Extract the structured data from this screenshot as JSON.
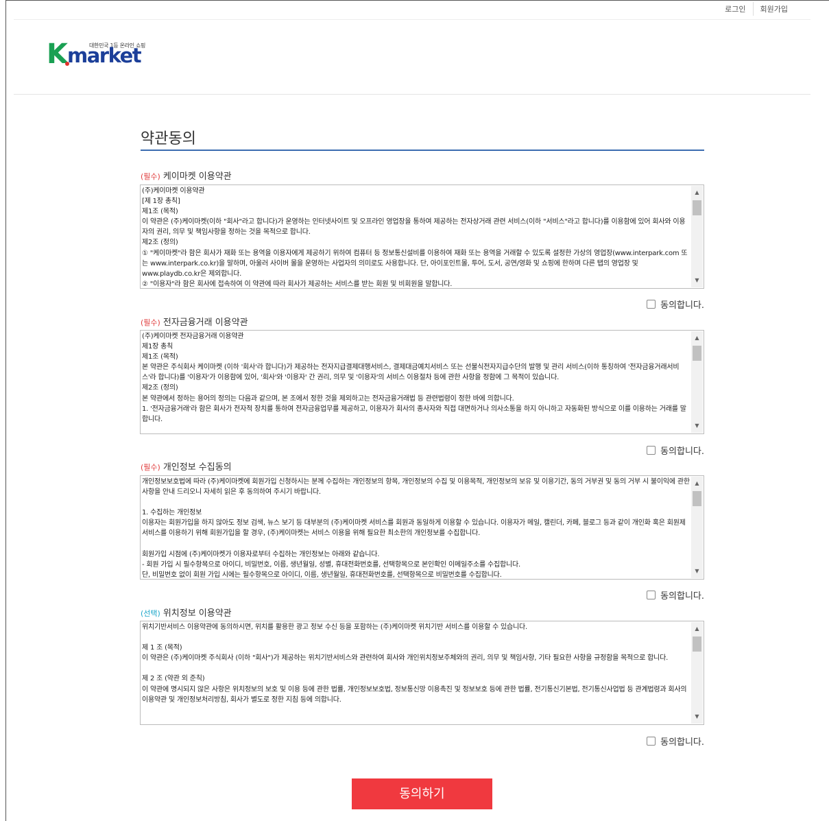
{
  "header": {
    "login_label": "로그인",
    "signup_label": "회원가입"
  },
  "logo": {
    "tagline": "대한민국 1등 온라인 쇼핑",
    "k": "K",
    "word": "market"
  },
  "page_title": "약관동의",
  "sections": [
    {
      "tag": "(필수)",
      "title": "케이마켓 이용약관",
      "text": "(주)케이마켓 이용약관\n[제 1장 총칙]\n제1조 (목적)\n이 약관은 (주)케이마켓(이하 \"회사\"라고 합니다)가 운영하는 인터넷사이트 및 오프라인 영업장을 통하여 제공하는 전자상거래 관련 서비스(이하 \"서비스\"라고 합니다)를 이용함에 있어 회사와 이용자의 권리, 의무 및 책임사항을 정하는 것을 목적으로 합니다.\n제2조 (정의)\n① \"케이마켓\"라 함은 회사가 재화 또는 용역을 이용자에게 제공하기 위하여 컴퓨터 등 정보통신설비를 이용하여 재화 또는 용역을 거래할 수 있도록 설정한 가상의 영업장(www.interpark.com 또는 www.interpark.co.kr)을 말하며, 아울러 사이버 몰을 운영하는 사업자의 의미로도 사용합니다. 단, 아이포인트몰, 투어, 도서, 공연/영화 및 쇼핑에 한하며 다른 탭의 영업장 및 www.playdb.co.kr은 제외합니다.\n② \"이용자\"라 함은 회사에 접속하여 이 약관에 따라 회사가 제공하는 서비스를 받는 회원 및 비회원을 말합니다.",
      "agree_label": "동의합니다."
    },
    {
      "tag": "(필수)",
      "title": "전자금융거래 이용약관",
      "text": "(주)케이마켓 전자금융거래 이용약관\n제1장 총칙\n제1조 (목적)\n본 약관은 주식회사 케이마켓 (이하 '회사'라 합니다)가 제공하는 전자지급결제대행서비스, 결제대금예치서비스 또는 선불식전자지급수단의 발행 및 관리 서비스(이하 통칭하여 '전자금융거래서비스'라 합니다)를 '이용자'가 이용함에 있어, '회사'와 '이용자' 간 권리, 의무 및 '이용자'의 서비스 이용절차 등에 관한 사항을 정함에 그 목적이 있습니다.\n제2조 (정의)\n본 약관에서 정하는 용어의 정의는 다음과 같으며, 본 조에서 정한 것을 제외하고는 전자금융거래법 등 관련법령이 정한 바에 의합니다.\n1. '전자금융거래'라 함은 회사가 전자적 장치를 통하여 전자금융업무를 제공하고, 이용자가 회사의 종사자와 직접 대면하거나 의사소통을 하지 아니하고 자동화된 방식으로 이를 이용하는 거래를 말합니다.",
      "agree_label": "동의합니다."
    },
    {
      "tag": "(필수)",
      "title": "개인정보 수집동의",
      "text": "개인정보보호법에 따라 (주)케이마켓에 회원가입 신청하시는 분께 수집하는 개인정보의 항목, 개인정보의 수집 및 이용목적, 개인정보의 보유 및 이용기간, 동의 거부권 및 동의 거부 시 불이익에 관한 사항을 안내 드리오니 자세히 읽은 후 동의하여 주시기 바랍니다.\n\n1. 수집하는 개인정보\n이용자는 회원가입을 하지 않아도 정보 검색, 뉴스 보기 등 대부분의 (주)케이마켓 서비스를 회원과 동일하게 이용할 수 있습니다. 이용자가 메일, 캘린더, 카페, 블로그 등과 같이 개인화 혹은 회원제 서비스를 이용하기 위해 회원가입을 할 경우, (주)케이마켓는 서비스 이용을 위해 필요한 최소한의 개인정보를 수집합니다.\n\n회원가입 시점에 (주)케이마켓가 이용자로부터 수집하는 개인정보는 아래와 같습니다.\n- 회원 가입 시 필수항목으로 아이디, 비밀번호, 이름, 생년월일, 성별, 휴대전화번호를, 선택항목으로 본인확인 이메일주소를 수집합니다.\n단, 비밀번호 없이 회원 가입 시에는 필수항목으로 아이디, 이름, 생년월일, 휴대전화번호를, 선택항목으로 비밀번호를 수집합니다.",
      "agree_label": "동의합니다."
    },
    {
      "tag": "(선택)",
      "title": "위치정보 이용약관",
      "text": "위치기반서비스 이용약관에 동의하시면, 위치를 활용한 광고 정보 수신 등을 포함하는 (주)케이마켓 위치기반 서비스를 이용할 수 있습니다.\n\n제 1 조 (목적)\n이 약관은 (주)케이마켓 주식회사 (이하 \"회사\")가 제공하는 위치기반서비스와 관련하여 회사와 개인위치정보주체와의 권리, 의무 및 책임사항, 기타 필요한 사항을 규정함을 목적으로 합니다.\n\n제 2 조 (약관 외 준칙)\n이 약관에 명시되지 않은 사항은 위치정보의 보호 및 이용 등에 관한 법률, 개인정보보호법, 정보통신망 이용촉진 및 정보보호 등에 관한 법률, 전기통신기본법, 전기통신사업법 등 관계법령과 회사의 이용약관 및 개인정보처리방침, 회사가 별도로 정한 지침 등에 의합니다.",
      "agree_label": "동의합니다."
    }
  ],
  "submit_label": "동의하기",
  "colors": {
    "required_tag": "#e03c3c",
    "optional_tag": "#1aa6c9",
    "submit_bg": "#f0393f",
    "title_underline": "#3a6bb0"
  }
}
